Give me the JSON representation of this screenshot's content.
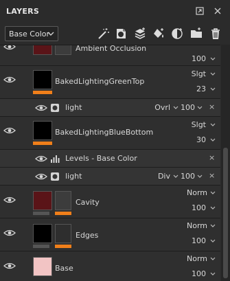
{
  "panel": {
    "title": "LAYERS",
    "channel": "Base Color"
  },
  "colors": {
    "accent_orange": "#f07f1a",
    "panel_bg": "#2b2b2b",
    "row_bg": "#2f2f2f"
  },
  "layers": [
    {
      "name": "Ambient Occlusion",
      "blend": "",
      "opacity": "100"
    },
    {
      "name": "BakedLightingGreenTop",
      "blend": "Slgt",
      "opacity": "23"
    },
    {
      "name": "BakedLightingBlueBottom",
      "blend": "Slgt",
      "opacity": "30"
    },
    {
      "name": "Cavity",
      "blend": "Norm",
      "opacity": "100"
    },
    {
      "name": "Edges",
      "blend": "Norm",
      "opacity": "100"
    },
    {
      "name": "Base",
      "blend": "Norm",
      "opacity": "100"
    }
  ],
  "effects": [
    {
      "name": "light",
      "blend": "Ovrl",
      "opacity": "100"
    },
    {
      "name": "Levels - Base Color",
      "blend": "",
      "opacity": ""
    },
    {
      "name": "light",
      "blend": "Div",
      "opacity": "100"
    }
  ],
  "icons": {
    "close": "×"
  }
}
